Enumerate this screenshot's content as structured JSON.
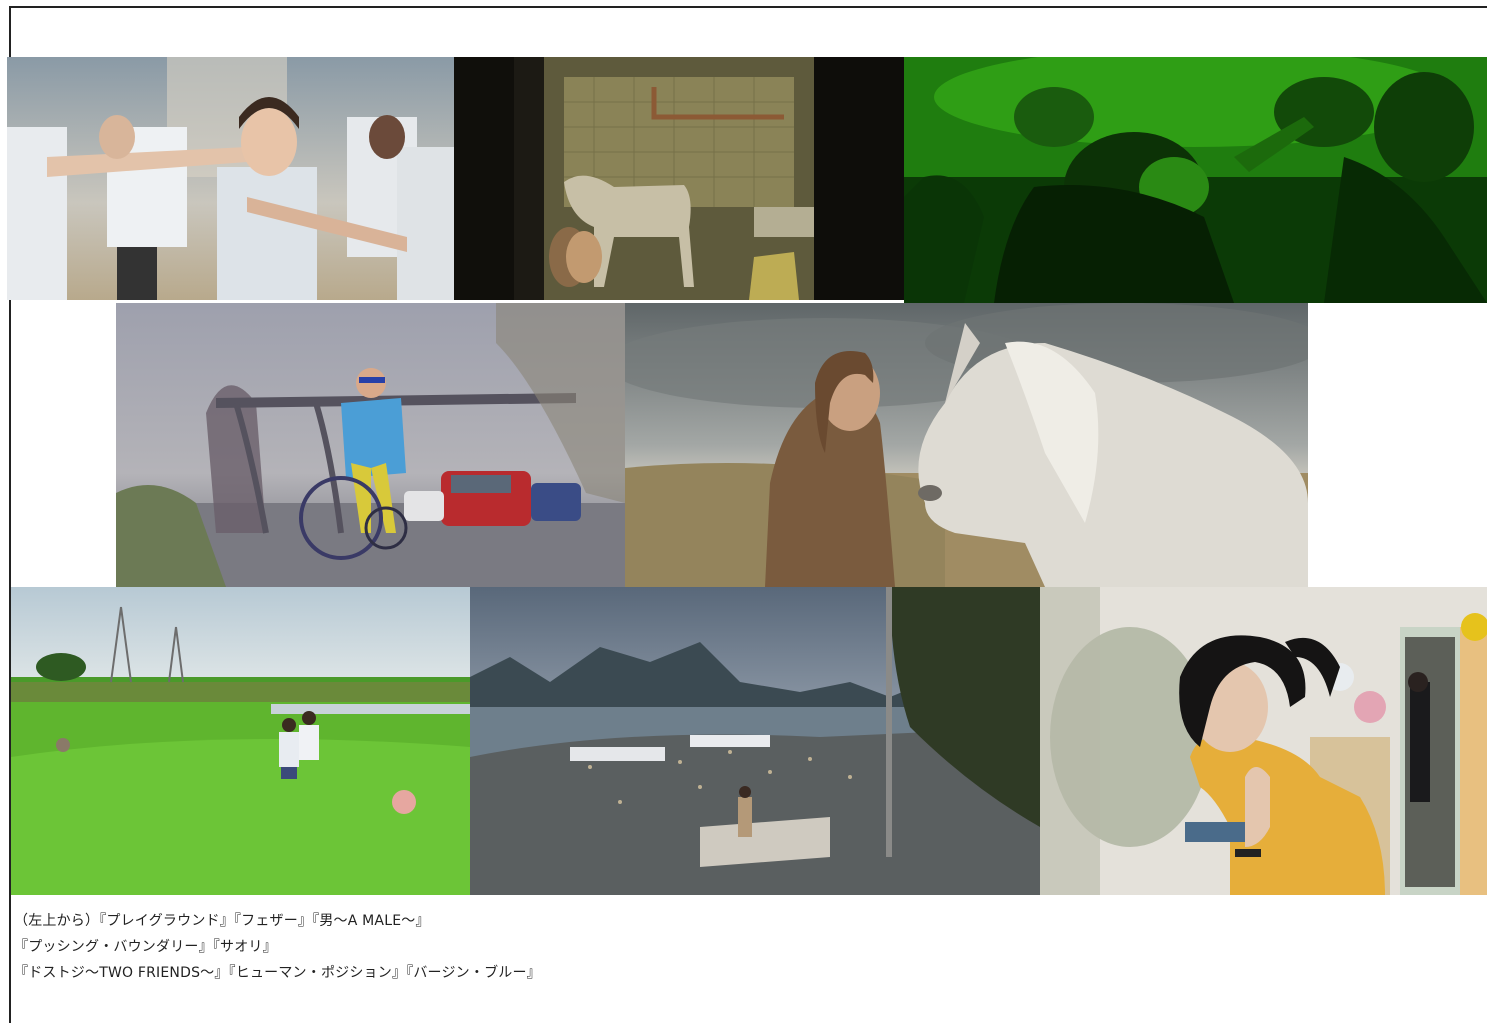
{
  "caption": {
    "line1": "（左上から）『プレイグラウンド』『フェザー』『男〜A MALE〜』",
    "line2": "『プッシング・バウンダリー』『サオリ』",
    "line3": "『ドストジ〜TWO FRIENDS〜』『ヒューマン・ポジション』『バージン・ブルー』"
  },
  "photos": [
    {
      "film": "プレイグラウンド",
      "scene": "children in white shirts stretching arms in a gym"
    },
    {
      "film": "フェザー",
      "scene": "donkey and children in a dim tiled room"
    },
    {
      "film": "男〜A MALE〜",
      "scene": "crowd dancing under green light"
    },
    {
      "film": "プッシング・バウンダリー",
      "scene": "man in wheelchair on a road beside a railway bridge"
    },
    {
      "film": "サオリ",
      "scene": "young woman facing a white horse under a cloudy sky"
    },
    {
      "film": "ドストジ〜TWO FRIENDS〜",
      "scene": "two boys walking through a green rice field"
    },
    {
      "film": "ヒューマン・ポジション",
      "scene": "woman standing above a harbour town at dusk"
    },
    {
      "film": "バージン・ブルー",
      "scene": "woman in a yellow shirt looking down beside a mirror"
    }
  ]
}
